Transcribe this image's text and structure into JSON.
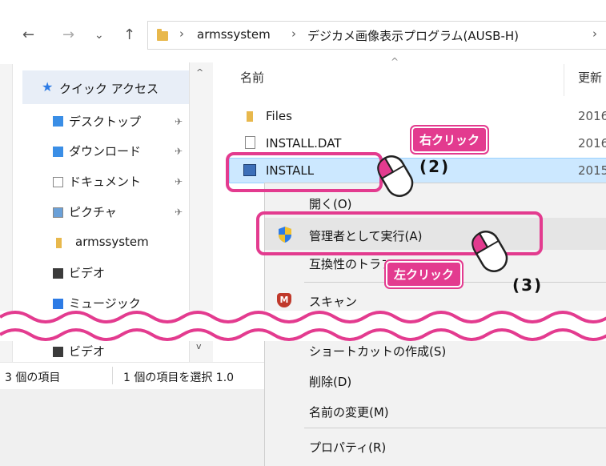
{
  "address": {
    "back": "←",
    "forward": "→",
    "recent": "⌄",
    "up": "↑",
    "crumb1": "armssystem",
    "crumb2": "デジカメ画像表示プログラム(AUSB-H)",
    "sep": "›"
  },
  "nav_pane": {
    "items": [
      {
        "label": "クイック アクセス"
      },
      {
        "label": "デスクトップ"
      },
      {
        "label": "ダウンロード"
      },
      {
        "label": "ドキュメント"
      },
      {
        "label": "ピクチャ"
      },
      {
        "label": "armssystem"
      },
      {
        "label": "ビデオ"
      },
      {
        "label": "ミュージック"
      },
      {
        "label": "ビデオ"
      }
    ]
  },
  "file_list": {
    "col_name": "名前",
    "col_modified": "更新",
    "rows": [
      {
        "name": "Files",
        "date": "2016"
      },
      {
        "name": "INSTALL.DAT",
        "date": "2016"
      },
      {
        "name": "INSTALL",
        "date": "2015"
      }
    ]
  },
  "status_bar": {
    "count": "3 個の項目",
    "selected": "1 個の項目を選択 1.0"
  },
  "context_menu": {
    "items": [
      {
        "label": "開く(O)"
      },
      {
        "label": "管理者として実行(A)"
      },
      {
        "label": "互換性のトラブルシューティング"
      },
      {
        "label": "スキャン"
      },
      {
        "label": "ショートカットの作成(S)"
      },
      {
        "label": "削除(D)"
      },
      {
        "label": "名前の変更(M)"
      },
      {
        "label": "プロパティ(R)"
      }
    ]
  },
  "annotations": {
    "right_click": "右クリック",
    "left_click": "左クリック",
    "step2": "(2)",
    "step3": "(3)"
  },
  "colors": {
    "accent_pink": "#e33b8f",
    "selection": "#cce8ff",
    "folder": "#e8b84c"
  }
}
